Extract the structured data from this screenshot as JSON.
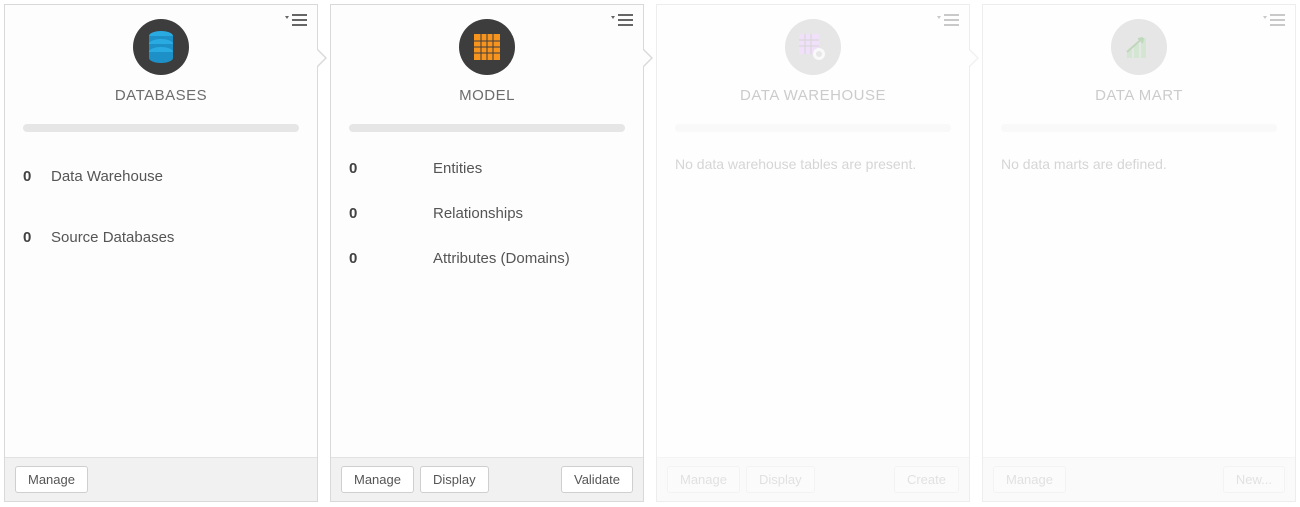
{
  "cards": {
    "databases": {
      "title": "DATABASES",
      "rows": [
        {
          "count": "0",
          "label": "Data Warehouse"
        },
        {
          "count": "0",
          "label": "Source Databases"
        }
      ],
      "buttons": {
        "manage": "Manage"
      }
    },
    "model": {
      "title": "MODEL",
      "rows": [
        {
          "count": "0",
          "label": "Entities"
        },
        {
          "count": "0",
          "label": "Relationships"
        },
        {
          "count": "0",
          "label": "Attributes (Domains)"
        }
      ],
      "buttons": {
        "manage": "Manage",
        "display": "Display",
        "validate": "Validate"
      }
    },
    "warehouse": {
      "title": "DATA WAREHOUSE",
      "empty": "No data warehouse tables are present.",
      "buttons": {
        "manage": "Manage",
        "display": "Display",
        "create": "Create"
      }
    },
    "datamart": {
      "title": "DATA MART",
      "empty": "No data marts are defined.",
      "buttons": {
        "manage": "Manage",
        "new": "New..."
      }
    }
  }
}
